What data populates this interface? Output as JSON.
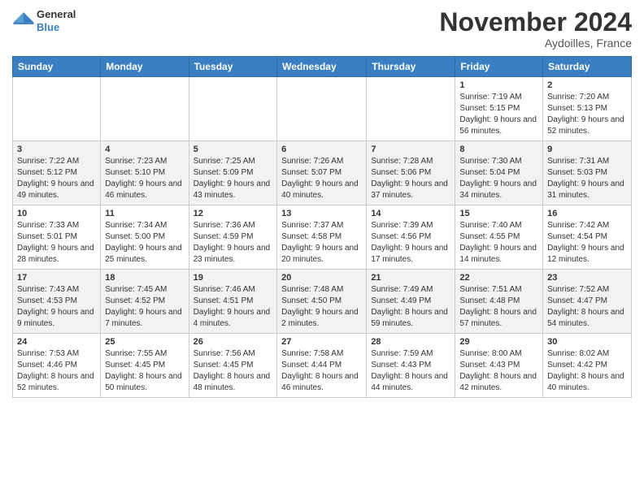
{
  "header": {
    "logo_general": "General",
    "logo_blue": "Blue",
    "month": "November 2024",
    "location": "Aydoilles, France"
  },
  "days_of_week": [
    "Sunday",
    "Monday",
    "Tuesday",
    "Wednesday",
    "Thursday",
    "Friday",
    "Saturday"
  ],
  "weeks": [
    [
      {
        "day": "",
        "info": ""
      },
      {
        "day": "",
        "info": ""
      },
      {
        "day": "",
        "info": ""
      },
      {
        "day": "",
        "info": ""
      },
      {
        "day": "",
        "info": ""
      },
      {
        "day": "1",
        "info": "Sunrise: 7:19 AM\nSunset: 5:15 PM\nDaylight: 9 hours and 56 minutes."
      },
      {
        "day": "2",
        "info": "Sunrise: 7:20 AM\nSunset: 5:13 PM\nDaylight: 9 hours and 52 minutes."
      }
    ],
    [
      {
        "day": "3",
        "info": "Sunrise: 7:22 AM\nSunset: 5:12 PM\nDaylight: 9 hours and 49 minutes."
      },
      {
        "day": "4",
        "info": "Sunrise: 7:23 AM\nSunset: 5:10 PM\nDaylight: 9 hours and 46 minutes."
      },
      {
        "day": "5",
        "info": "Sunrise: 7:25 AM\nSunset: 5:09 PM\nDaylight: 9 hours and 43 minutes."
      },
      {
        "day": "6",
        "info": "Sunrise: 7:26 AM\nSunset: 5:07 PM\nDaylight: 9 hours and 40 minutes."
      },
      {
        "day": "7",
        "info": "Sunrise: 7:28 AM\nSunset: 5:06 PM\nDaylight: 9 hours and 37 minutes."
      },
      {
        "day": "8",
        "info": "Sunrise: 7:30 AM\nSunset: 5:04 PM\nDaylight: 9 hours and 34 minutes."
      },
      {
        "day": "9",
        "info": "Sunrise: 7:31 AM\nSunset: 5:03 PM\nDaylight: 9 hours and 31 minutes."
      }
    ],
    [
      {
        "day": "10",
        "info": "Sunrise: 7:33 AM\nSunset: 5:01 PM\nDaylight: 9 hours and 28 minutes."
      },
      {
        "day": "11",
        "info": "Sunrise: 7:34 AM\nSunset: 5:00 PM\nDaylight: 9 hours and 25 minutes."
      },
      {
        "day": "12",
        "info": "Sunrise: 7:36 AM\nSunset: 4:59 PM\nDaylight: 9 hours and 23 minutes."
      },
      {
        "day": "13",
        "info": "Sunrise: 7:37 AM\nSunset: 4:58 PM\nDaylight: 9 hours and 20 minutes."
      },
      {
        "day": "14",
        "info": "Sunrise: 7:39 AM\nSunset: 4:56 PM\nDaylight: 9 hours and 17 minutes."
      },
      {
        "day": "15",
        "info": "Sunrise: 7:40 AM\nSunset: 4:55 PM\nDaylight: 9 hours and 14 minutes."
      },
      {
        "day": "16",
        "info": "Sunrise: 7:42 AM\nSunset: 4:54 PM\nDaylight: 9 hours and 12 minutes."
      }
    ],
    [
      {
        "day": "17",
        "info": "Sunrise: 7:43 AM\nSunset: 4:53 PM\nDaylight: 9 hours and 9 minutes."
      },
      {
        "day": "18",
        "info": "Sunrise: 7:45 AM\nSunset: 4:52 PM\nDaylight: 9 hours and 7 minutes."
      },
      {
        "day": "19",
        "info": "Sunrise: 7:46 AM\nSunset: 4:51 PM\nDaylight: 9 hours and 4 minutes."
      },
      {
        "day": "20",
        "info": "Sunrise: 7:48 AM\nSunset: 4:50 PM\nDaylight: 9 hours and 2 minutes."
      },
      {
        "day": "21",
        "info": "Sunrise: 7:49 AM\nSunset: 4:49 PM\nDaylight: 8 hours and 59 minutes."
      },
      {
        "day": "22",
        "info": "Sunrise: 7:51 AM\nSunset: 4:48 PM\nDaylight: 8 hours and 57 minutes."
      },
      {
        "day": "23",
        "info": "Sunrise: 7:52 AM\nSunset: 4:47 PM\nDaylight: 8 hours and 54 minutes."
      }
    ],
    [
      {
        "day": "24",
        "info": "Sunrise: 7:53 AM\nSunset: 4:46 PM\nDaylight: 8 hours and 52 minutes."
      },
      {
        "day": "25",
        "info": "Sunrise: 7:55 AM\nSunset: 4:45 PM\nDaylight: 8 hours and 50 minutes."
      },
      {
        "day": "26",
        "info": "Sunrise: 7:56 AM\nSunset: 4:45 PM\nDaylight: 8 hours and 48 minutes."
      },
      {
        "day": "27",
        "info": "Sunrise: 7:58 AM\nSunset: 4:44 PM\nDaylight: 8 hours and 46 minutes."
      },
      {
        "day": "28",
        "info": "Sunrise: 7:59 AM\nSunset: 4:43 PM\nDaylight: 8 hours and 44 minutes."
      },
      {
        "day": "29",
        "info": "Sunrise: 8:00 AM\nSunset: 4:43 PM\nDaylight: 8 hours and 42 minutes."
      },
      {
        "day": "30",
        "info": "Sunrise: 8:02 AM\nSunset: 4:42 PM\nDaylight: 8 hours and 40 minutes."
      }
    ]
  ]
}
